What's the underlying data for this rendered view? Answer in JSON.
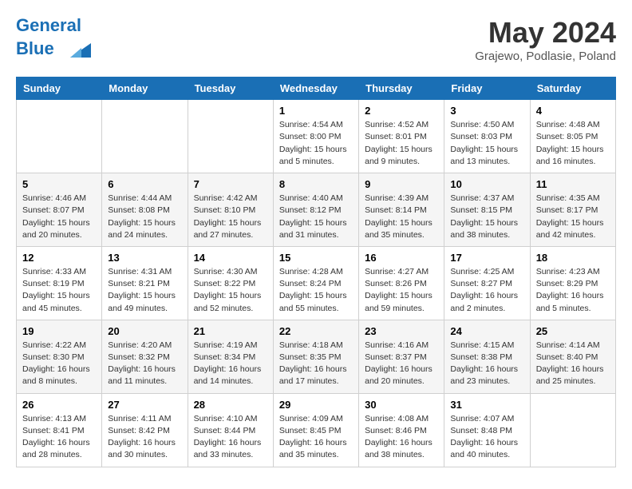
{
  "header": {
    "logo_line1": "General",
    "logo_line2": "Blue",
    "month_title": "May 2024",
    "location": "Grajewo, Podlasie, Poland"
  },
  "days_of_week": [
    "Sunday",
    "Monday",
    "Tuesday",
    "Wednesday",
    "Thursday",
    "Friday",
    "Saturday"
  ],
  "weeks": [
    [
      {
        "day": "",
        "info": ""
      },
      {
        "day": "",
        "info": ""
      },
      {
        "day": "",
        "info": ""
      },
      {
        "day": "1",
        "info": "Sunrise: 4:54 AM\nSunset: 8:00 PM\nDaylight: 15 hours\nand 5 minutes."
      },
      {
        "day": "2",
        "info": "Sunrise: 4:52 AM\nSunset: 8:01 PM\nDaylight: 15 hours\nand 9 minutes."
      },
      {
        "day": "3",
        "info": "Sunrise: 4:50 AM\nSunset: 8:03 PM\nDaylight: 15 hours\nand 13 minutes."
      },
      {
        "day": "4",
        "info": "Sunrise: 4:48 AM\nSunset: 8:05 PM\nDaylight: 15 hours\nand 16 minutes."
      }
    ],
    [
      {
        "day": "5",
        "info": "Sunrise: 4:46 AM\nSunset: 8:07 PM\nDaylight: 15 hours\nand 20 minutes."
      },
      {
        "day": "6",
        "info": "Sunrise: 4:44 AM\nSunset: 8:08 PM\nDaylight: 15 hours\nand 24 minutes."
      },
      {
        "day": "7",
        "info": "Sunrise: 4:42 AM\nSunset: 8:10 PM\nDaylight: 15 hours\nand 27 minutes."
      },
      {
        "day": "8",
        "info": "Sunrise: 4:40 AM\nSunset: 8:12 PM\nDaylight: 15 hours\nand 31 minutes."
      },
      {
        "day": "9",
        "info": "Sunrise: 4:39 AM\nSunset: 8:14 PM\nDaylight: 15 hours\nand 35 minutes."
      },
      {
        "day": "10",
        "info": "Sunrise: 4:37 AM\nSunset: 8:15 PM\nDaylight: 15 hours\nand 38 minutes."
      },
      {
        "day": "11",
        "info": "Sunrise: 4:35 AM\nSunset: 8:17 PM\nDaylight: 15 hours\nand 42 minutes."
      }
    ],
    [
      {
        "day": "12",
        "info": "Sunrise: 4:33 AM\nSunset: 8:19 PM\nDaylight: 15 hours\nand 45 minutes."
      },
      {
        "day": "13",
        "info": "Sunrise: 4:31 AM\nSunset: 8:21 PM\nDaylight: 15 hours\nand 49 minutes."
      },
      {
        "day": "14",
        "info": "Sunrise: 4:30 AM\nSunset: 8:22 PM\nDaylight: 15 hours\nand 52 minutes."
      },
      {
        "day": "15",
        "info": "Sunrise: 4:28 AM\nSunset: 8:24 PM\nDaylight: 15 hours\nand 55 minutes."
      },
      {
        "day": "16",
        "info": "Sunrise: 4:27 AM\nSunset: 8:26 PM\nDaylight: 15 hours\nand 59 minutes."
      },
      {
        "day": "17",
        "info": "Sunrise: 4:25 AM\nSunset: 8:27 PM\nDaylight: 16 hours\nand 2 minutes."
      },
      {
        "day": "18",
        "info": "Sunrise: 4:23 AM\nSunset: 8:29 PM\nDaylight: 16 hours\nand 5 minutes."
      }
    ],
    [
      {
        "day": "19",
        "info": "Sunrise: 4:22 AM\nSunset: 8:30 PM\nDaylight: 16 hours\nand 8 minutes."
      },
      {
        "day": "20",
        "info": "Sunrise: 4:20 AM\nSunset: 8:32 PM\nDaylight: 16 hours\nand 11 minutes."
      },
      {
        "day": "21",
        "info": "Sunrise: 4:19 AM\nSunset: 8:34 PM\nDaylight: 16 hours\nand 14 minutes."
      },
      {
        "day": "22",
        "info": "Sunrise: 4:18 AM\nSunset: 8:35 PM\nDaylight: 16 hours\nand 17 minutes."
      },
      {
        "day": "23",
        "info": "Sunrise: 4:16 AM\nSunset: 8:37 PM\nDaylight: 16 hours\nand 20 minutes."
      },
      {
        "day": "24",
        "info": "Sunrise: 4:15 AM\nSunset: 8:38 PM\nDaylight: 16 hours\nand 23 minutes."
      },
      {
        "day": "25",
        "info": "Sunrise: 4:14 AM\nSunset: 8:40 PM\nDaylight: 16 hours\nand 25 minutes."
      }
    ],
    [
      {
        "day": "26",
        "info": "Sunrise: 4:13 AM\nSunset: 8:41 PM\nDaylight: 16 hours\nand 28 minutes."
      },
      {
        "day": "27",
        "info": "Sunrise: 4:11 AM\nSunset: 8:42 PM\nDaylight: 16 hours\nand 30 minutes."
      },
      {
        "day": "28",
        "info": "Sunrise: 4:10 AM\nSunset: 8:44 PM\nDaylight: 16 hours\nand 33 minutes."
      },
      {
        "day": "29",
        "info": "Sunrise: 4:09 AM\nSunset: 8:45 PM\nDaylight: 16 hours\nand 35 minutes."
      },
      {
        "day": "30",
        "info": "Sunrise: 4:08 AM\nSunset: 8:46 PM\nDaylight: 16 hours\nand 38 minutes."
      },
      {
        "day": "31",
        "info": "Sunrise: 4:07 AM\nSunset: 8:48 PM\nDaylight: 16 hours\nand 40 minutes."
      },
      {
        "day": "",
        "info": ""
      }
    ]
  ]
}
